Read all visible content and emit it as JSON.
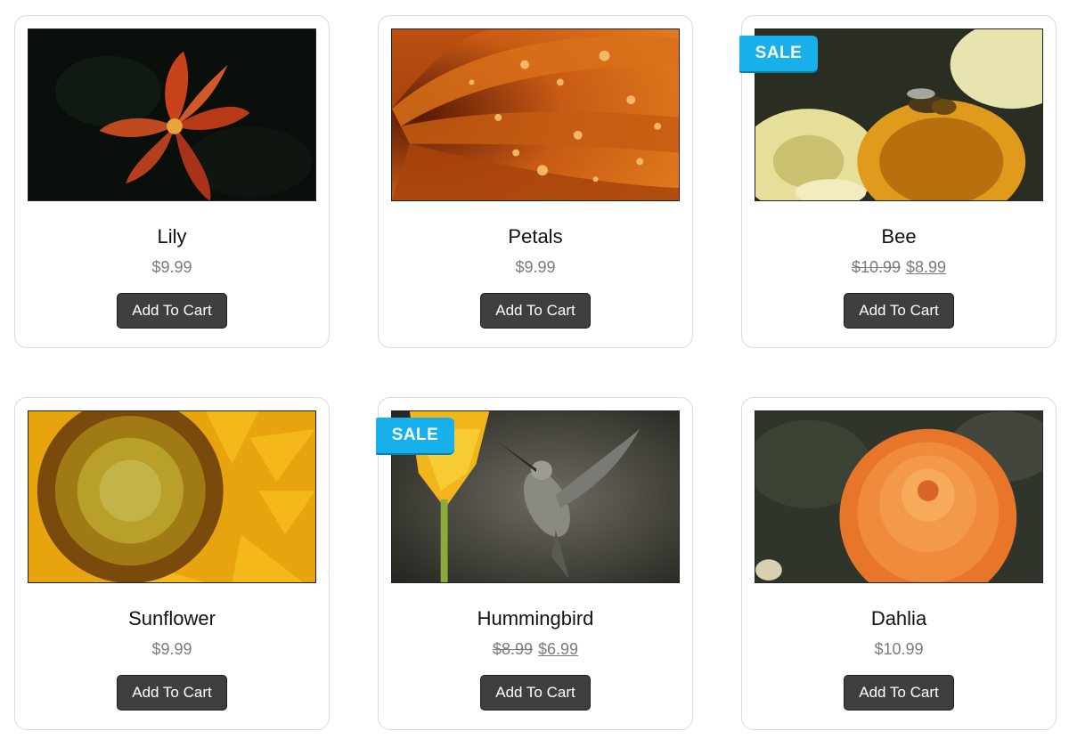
{
  "products": [
    {
      "name": "Lily",
      "price": "$9.99",
      "button": "Add To Cart"
    },
    {
      "name": "Petals",
      "price": "$9.99",
      "button": "Add To Cart"
    },
    {
      "name": "Bee",
      "old_price": "$10.99",
      "sale_price": "$8.99",
      "badge": "SALE",
      "button": "Add To Cart"
    },
    {
      "name": "Sunflower",
      "price": "$9.99",
      "button": "Add To Cart"
    },
    {
      "name": "Hummingbird",
      "old_price": "$8.99",
      "sale_price": "$6.99",
      "badge": "SALE",
      "button": "Add To Cart"
    },
    {
      "name": "Dahlia",
      "price": "$10.99",
      "button": "Add To Cart"
    }
  ],
  "colors": {
    "sale_badge": "#17b0ea",
    "button_bg": "#3f3f3f",
    "price_text": "#7b7b7b",
    "card_border": "#d9d9d9"
  }
}
